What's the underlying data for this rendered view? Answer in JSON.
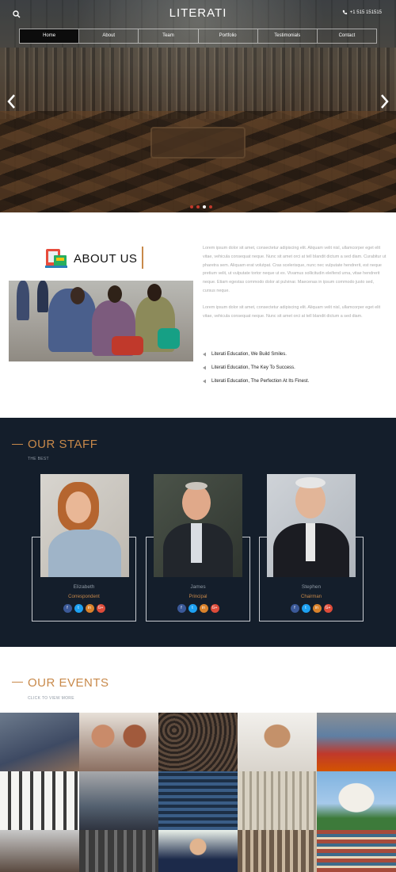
{
  "brand": "LITERATI",
  "phone": "+1 515 151515",
  "nav": [
    "Home",
    "About",
    "Team",
    "Portfolio",
    "Testimonials",
    "Contact"
  ],
  "about": {
    "title": "ABOUT US",
    "paragraph1": "Lorem ipsum dolor sit amet, consectetur adipiscing elit. Aliquam velit nisl, ullamcorper eget elit vitae, vehicula consequat neque. Nunc sit amet orci at tell blandit dictum a sed diam. Curabitur ut pharetra sem. Aliquam erat volutpat. Cras scelerisque, nunc nec vulputate hendrerit, est neque pretium velit, ut vulputate tortor neque ut ex. Vivamus sollicitudin eleifend urna, vitae hendrerit neque. Etiam egestas commodo dolor at pulvinar. Maecenas in ipsum commodo justo sed, cursus neque.",
    "paragraph2": "Lorem ipsum dolor sit amet, consectetur adipiscing elit. Aliquam velit nisl, ullamcorper eget elit vitae, vehicula consequat neque. Nunc sit amet orci at tell blandit dictum a sed diam.",
    "bullets": [
      "Literati Education, We Build Smiles.",
      "Literati Education, The Key To Success.",
      "Literati Education, The Perfection At Its Finest."
    ]
  },
  "staff": {
    "title": "OUR STAFF",
    "subtitle": "THE BEST",
    "members": [
      {
        "name": "Elizabeth",
        "role": "Correspondent"
      },
      {
        "name": "James",
        "role": "Principal"
      },
      {
        "name": "Stephen",
        "role": "Chairman"
      }
    ],
    "social": [
      "f",
      "t",
      "in",
      "G+"
    ]
  },
  "events": {
    "title": "OUR EVENTS",
    "subtitle": "CLICK TO VIEW MORE"
  },
  "colors": {
    "accent": "#c8894a",
    "staff_bg": "#141e2b",
    "nav_active": "#0c0c0c"
  }
}
